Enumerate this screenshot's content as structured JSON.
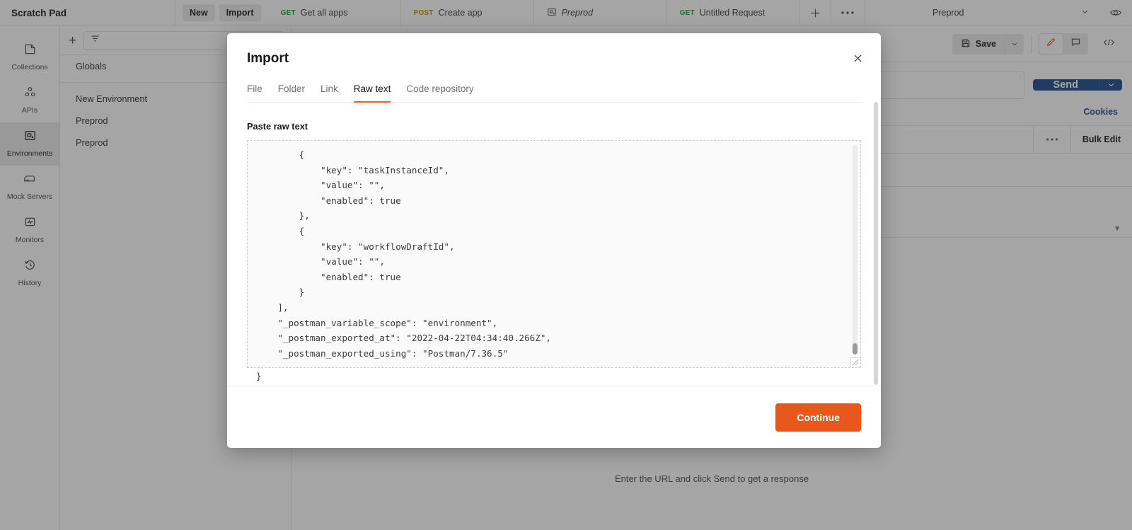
{
  "topbar": {
    "workspace": "Scratch Pad",
    "new_label": "New",
    "import_label": "Import",
    "tabs": [
      {
        "verb": "GET",
        "name": "Get all apps",
        "kind": "request"
      },
      {
        "verb": "POST",
        "name": "Create app",
        "kind": "request"
      },
      {
        "verb": "ENV",
        "name": "Preprod",
        "kind": "environment"
      },
      {
        "verb": "GET",
        "name": "Untitled Request",
        "kind": "request"
      }
    ],
    "plus_icon": "plus-icon",
    "more_icon": "ellipsis-icon",
    "env_selector_value": "Preprod",
    "eye_icon": "eye-icon"
  },
  "rail": {
    "items": [
      {
        "label": "Collections",
        "icon": "collections-icon",
        "active": false
      },
      {
        "label": "APIs",
        "icon": "apis-icon",
        "active": false
      },
      {
        "label": "Environments",
        "icon": "environments-icon",
        "active": true
      },
      {
        "label": "Mock Servers",
        "icon": "mock-servers-icon",
        "active": false
      },
      {
        "label": "Monitors",
        "icon": "monitors-icon",
        "active": false
      },
      {
        "label": "History",
        "icon": "history-icon",
        "active": false
      }
    ]
  },
  "env_panel": {
    "add_icon": "plus-icon",
    "filter_icon": "filter-icon",
    "search_placeholder": "",
    "globals_label": "Globals",
    "environments": [
      "New Environment",
      "Preprod",
      "Preprod"
    ]
  },
  "main": {
    "save_label": "Save",
    "save_icon": "save-icon",
    "save_caret_icon": "chevron-down-icon",
    "edit_icon": "pencil-icon",
    "comment_icon": "comment-icon",
    "code_icon": "code-icon",
    "url_value": "",
    "send_label": "Send",
    "send_caret_icon": "chevron-down-icon",
    "cookies_label": "Cookies",
    "params_col_end": "N",
    "params_more_icon": "ellipsis-icon",
    "bulk_edit_label": "Bulk Edit",
    "response_hint": "Enter the URL and click Send to get a response"
  },
  "modal": {
    "title": "Import",
    "close_icon": "close-icon",
    "tabs": [
      {
        "label": "File",
        "active": false
      },
      {
        "label": "Folder",
        "active": false
      },
      {
        "label": "Link",
        "active": false
      },
      {
        "label": "Raw text",
        "active": true
      },
      {
        "label": "Code repository",
        "active": false
      }
    ],
    "paste_label": "Paste raw text",
    "raw_text": "        {\n            \"key\": \"taskInstanceId\",\n            \"value\": \"\",\n            \"enabled\": true\n        },\n        {\n            \"key\": \"workflowDraftId\",\n            \"value\": \"\",\n            \"enabled\": true\n        }\n    ],\n    \"_postman_variable_scope\": \"environment\",\n    \"_postman_exported_at\": \"2022-04-22T04:34:40.266Z\",\n    \"_postman_exported_using\": \"Postman/7.36.5\"",
    "raw_text_overflow_line": "}",
    "continue_label": "Continue",
    "scrollbar": {
      "name": "textarea-scrollbar",
      "thumb_position": "bottom"
    }
  },
  "colors": {
    "accent_orange": "#ef5b25",
    "continue_orange": "#e8581c",
    "send_blue": "#1a4b8c",
    "get_green": "#2f8f4e",
    "post_yellow": "#c7870a",
    "link_blue": "#1a4b8c"
  }
}
